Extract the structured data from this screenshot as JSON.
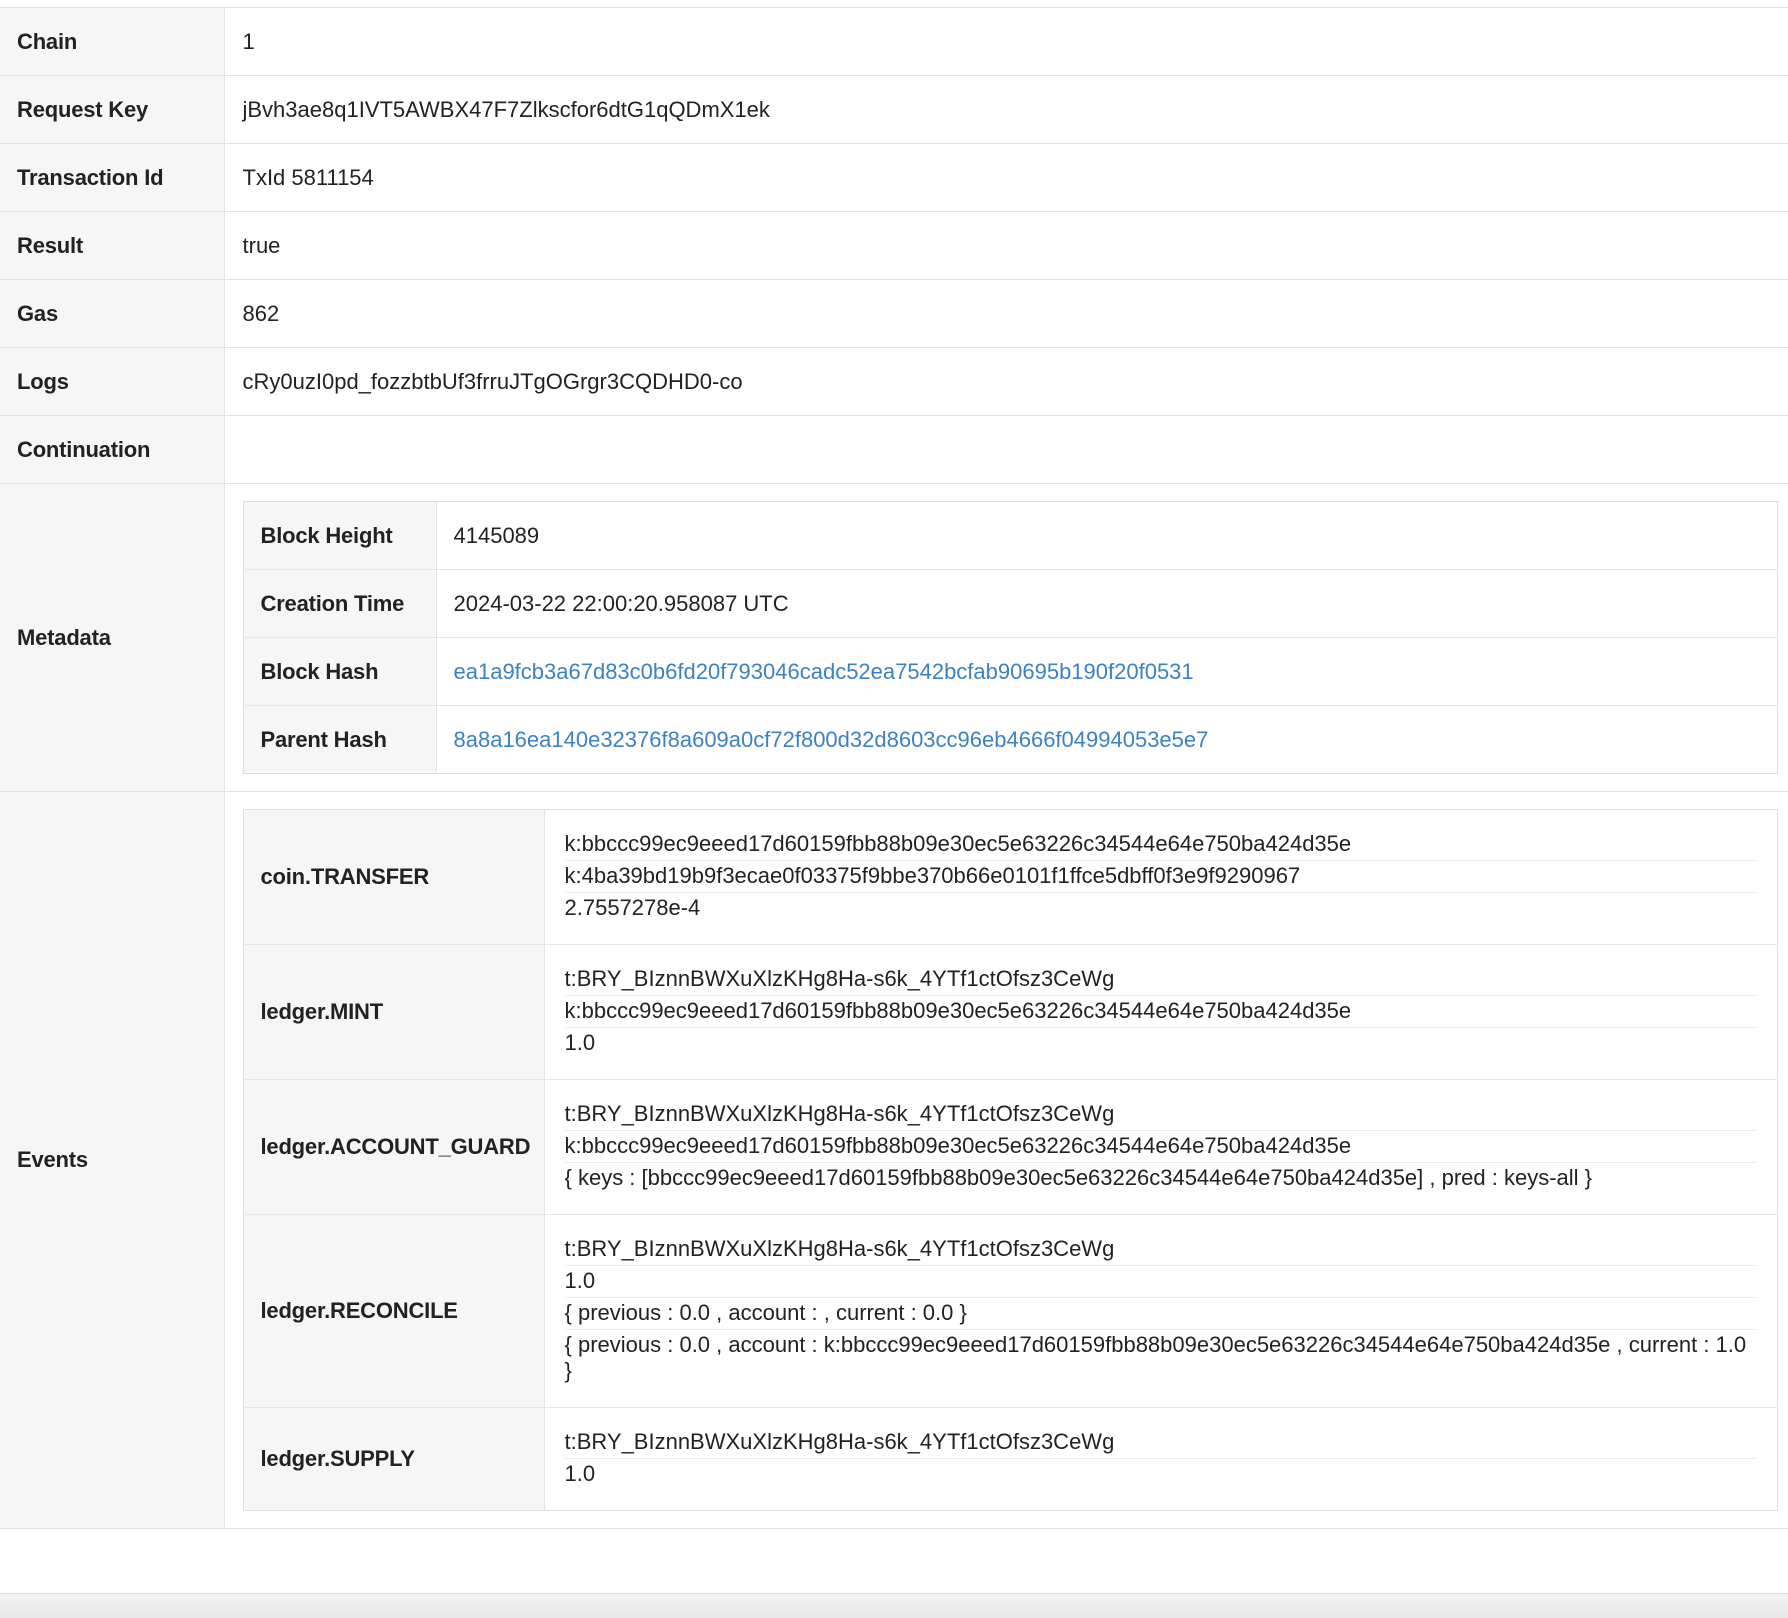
{
  "rows": {
    "chain": {
      "label": "Chain",
      "value": "1"
    },
    "request_key": {
      "label": "Request Key",
      "value": "jBvh3ae8q1IVT5AWBX47F7Zlkscfor6dtG1qQDmX1ek"
    },
    "transaction_id": {
      "label": "Transaction Id",
      "value": "TxId 5811154"
    },
    "result": {
      "label": "Result",
      "value": "true"
    },
    "gas": {
      "label": "Gas",
      "value": "862"
    },
    "logs": {
      "label": "Logs",
      "value": "cRy0uzI0pd_fozzbtbUf3frruJTgOGrgr3CQDHD0-co"
    },
    "continuation": {
      "label": "Continuation",
      "value": ""
    }
  },
  "metadata": {
    "label": "Metadata",
    "block_height": {
      "label": "Block Height",
      "value": "4145089"
    },
    "creation_time": {
      "label": "Creation Time",
      "value": "2024-03-22 22:00:20.958087 UTC"
    },
    "block_hash": {
      "label": "Block Hash",
      "value": "ea1a9fcb3a67d83c0b6fd20f793046cadc52ea7542bcfab90695b190f20f0531"
    },
    "parent_hash": {
      "label": "Parent Hash",
      "value": "8a8a16ea140e32376f8a609a0cf72f800d32d8603cc96eb4666f04994053e5e7"
    }
  },
  "events": {
    "label": "Events",
    "items": [
      {
        "name": "coin.TRANSFER",
        "params": [
          "k:bbccc99ec9eeed17d60159fbb88b09e30ec5e63226c34544e64e750ba424d35e",
          "k:4ba39bd19b9f3ecae0f03375f9bbe370b66e0101f1ffce5dbff0f3e9f9290967",
          "2.7557278e-4"
        ]
      },
      {
        "name": "ledger.MINT",
        "params": [
          "t:BRY_BIznnBWXuXlzKHg8Ha-s6k_4YTf1ctOfsz3CeWg",
          "k:bbccc99ec9eeed17d60159fbb88b09e30ec5e63226c34544e64e750ba424d35e",
          "1.0"
        ]
      },
      {
        "name": "ledger.ACCOUNT_GUARD",
        "params": [
          "t:BRY_BIznnBWXuXlzKHg8Ha-s6k_4YTf1ctOfsz3CeWg",
          "k:bbccc99ec9eeed17d60159fbb88b09e30ec5e63226c34544e64e750ba424d35e",
          "{ keys : [bbccc99ec9eeed17d60159fbb88b09e30ec5e63226c34544e64e750ba424d35e] , pred : keys-all }"
        ]
      },
      {
        "name": "ledger.RECONCILE",
        "params": [
          "t:BRY_BIznnBWXuXlzKHg8Ha-s6k_4YTf1ctOfsz3CeWg",
          "1.0",
          "{ previous : 0.0 , account : , current : 0.0 }",
          "{ previous : 0.0 , account : k:bbccc99ec9eeed17d60159fbb88b09e30ec5e63226c34544e64e750ba424d35e , current : 1.0 }"
        ]
      },
      {
        "name": "ledger.SUPPLY",
        "params": [
          "t:BRY_BIznnBWXuXlzKHg8Ha-s6k_4YTf1ctOfsz3CeWg",
          "1.0"
        ]
      }
    ]
  },
  "colors": {
    "link": "#3b82c4",
    "header_bg": "#f6f6f6",
    "border": "#e3e3e3"
  }
}
